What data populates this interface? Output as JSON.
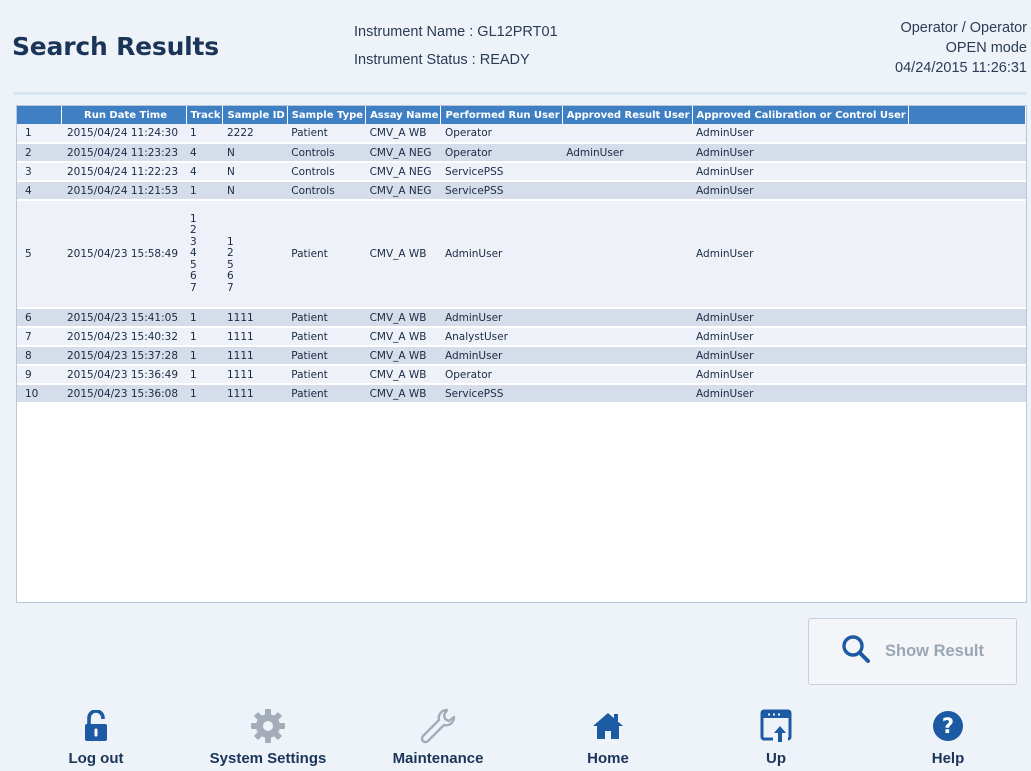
{
  "header": {
    "title": "Search Results",
    "instrument_name": "Instrument Name : GL12PRT01",
    "instrument_status": "Instrument Status : READY",
    "user": "Operator / Operator",
    "mode": "OPEN mode",
    "datetime": "04/24/2015 11:26:31"
  },
  "table": {
    "columns": [
      "",
      "Run Date Time",
      "Track",
      "Sample ID",
      "Sample Type",
      "Assay Name",
      "Performed Run User",
      "Approved Result User",
      "Approved Calibration or Control User",
      ""
    ],
    "rows": [
      {
        "no": "1",
        "date": "2015/04/24 11:24:30",
        "track": "1",
        "sample_id": "2222",
        "sample_type": "Patient",
        "assay": "CMV_A WB",
        "performed": "Operator",
        "approved": "",
        "cal_user": "AdminUser"
      },
      {
        "no": "2",
        "date": "2015/04/24 11:23:23",
        "track": "4",
        "sample_id": "N",
        "sample_type": "Controls",
        "assay": "CMV_A NEG",
        "performed": "Operator",
        "approved": "AdminUser",
        "cal_user": "AdminUser"
      },
      {
        "no": "3",
        "date": "2015/04/24 11:22:23",
        "track": "4",
        "sample_id": "N",
        "sample_type": "Controls",
        "assay": "CMV_A NEG",
        "performed": "ServicePSS",
        "approved": "",
        "cal_user": "AdminUser"
      },
      {
        "no": "4",
        "date": "2015/04/24 11:21:53",
        "track": "1",
        "sample_id": "N",
        "sample_type": "Controls",
        "assay": "CMV_A NEG",
        "performed": "ServicePSS",
        "approved": "",
        "cal_user": "AdminUser"
      },
      {
        "no": "5",
        "date": "2015/04/23 15:58:49",
        "track_lines": [
          "1",
          "2",
          "3",
          "4",
          "5",
          "6",
          "7"
        ],
        "sample_id_lines": [
          "",
          "",
          "1",
          "2",
          "5",
          "6",
          "7"
        ],
        "sample_type": "Patient",
        "assay": "CMV_A WB",
        "performed": "AdminUser",
        "approved": "",
        "cal_user": "AdminUser"
      },
      {
        "no": "6",
        "date": "2015/04/23 15:41:05",
        "track": "1",
        "sample_id": "1111",
        "sample_type": "Patient",
        "assay": "CMV_A WB",
        "performed": "AdminUser",
        "approved": "",
        "cal_user": "AdminUser"
      },
      {
        "no": "7",
        "date": "2015/04/23 15:40:32",
        "track": "1",
        "sample_id": "1111",
        "sample_type": "Patient",
        "assay": "CMV_A WB",
        "performed": "AnalystUser",
        "approved": "",
        "cal_user": "AdminUser"
      },
      {
        "no": "8",
        "date": "2015/04/23 15:37:28",
        "track": "1",
        "sample_id": "1111",
        "sample_type": "Patient",
        "assay": "CMV_A WB",
        "performed": "AdminUser",
        "approved": "",
        "cal_user": "AdminUser"
      },
      {
        "no": "9",
        "date": "2015/04/23 15:36:49",
        "track": "1",
        "sample_id": "1111",
        "sample_type": "Patient",
        "assay": "CMV_A WB",
        "performed": "Operator",
        "approved": "",
        "cal_user": "AdminUser"
      },
      {
        "no": "10",
        "date": "2015/04/23 15:36:08",
        "track": "1",
        "sample_id": "1111",
        "sample_type": "Patient",
        "assay": "CMV_A WB",
        "performed": "ServicePSS",
        "approved": "",
        "cal_user": "AdminUser"
      }
    ]
  },
  "actions": {
    "show_result": {
      "label": "Show Result",
      "icon": "search-icon",
      "enabled": false
    }
  },
  "nav": {
    "logout": {
      "label": "Log out",
      "icon": "unlock-icon"
    },
    "settings": {
      "label": "System Settings",
      "icon": "gear-icon"
    },
    "maintenance": {
      "label": "Maintenance",
      "icon": "wrench-icon"
    },
    "home": {
      "label": "Home",
      "icon": "home-icon"
    },
    "up": {
      "label": "Up",
      "icon": "up-window-icon"
    },
    "help": {
      "label": "Help",
      "icon": "help-icon"
    }
  },
  "colors": {
    "accent": "#3f7fc3",
    "title": "#1b3559",
    "icon_active": "#1c5aa3",
    "icon_disabled": "#a3acb8"
  }
}
